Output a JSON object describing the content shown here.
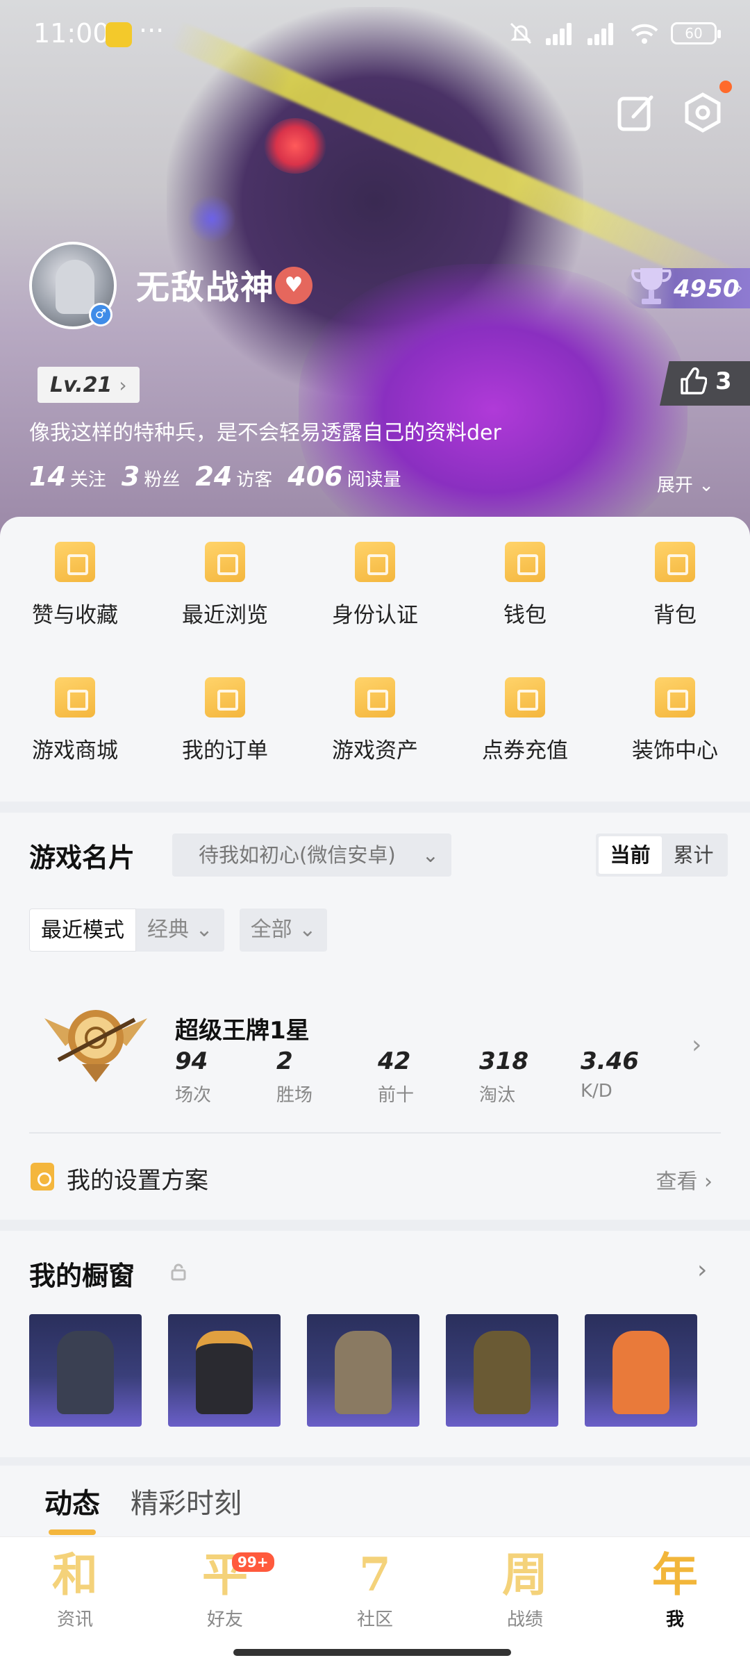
{
  "status_bar": {
    "time": "11:00",
    "battery": "60"
  },
  "profile": {
    "nickname": "无敌战神",
    "level": "Lv.21",
    "trophy_points": "4950",
    "likes": "3",
    "signature": "像我这样的特种兵，是不会轻易透露自己的资料der",
    "stats": [
      {
        "value": "14",
        "label": "关注"
      },
      {
        "value": "3",
        "label": "粉丝"
      },
      {
        "value": "24",
        "label": "访客"
      },
      {
        "value": "406",
        "label": "阅读量"
      }
    ],
    "expand_label": "展开"
  },
  "quick_actions": [
    {
      "label": "赞与收藏",
      "icon": "bookmark-heart-icon"
    },
    {
      "label": "最近浏览",
      "icon": "recent-icon"
    },
    {
      "label": "身份认证",
      "icon": "verified-icon"
    },
    {
      "label": "钱包",
      "icon": "wallet-icon"
    },
    {
      "label": "背包",
      "icon": "backpack-icon"
    },
    {
      "label": "游戏商城",
      "icon": "shop-bag-icon"
    },
    {
      "label": "我的订单",
      "icon": "orders-icon"
    },
    {
      "label": "游戏资产",
      "icon": "assets-icon"
    },
    {
      "label": "点券充值",
      "icon": "recharge-icon"
    },
    {
      "label": "装饰中心",
      "icon": "decoration-icon"
    }
  ],
  "game_card": {
    "title": "游戏名片",
    "account_select": "待我如初心(微信安卓)",
    "toggle": [
      "当前",
      "累计"
    ],
    "mode_chips": [
      "最近模式",
      "经典"
    ],
    "filter_chip": "全部",
    "rank_name": "超级王牌1星",
    "rank_stats": [
      {
        "value": "94",
        "label": "场次"
      },
      {
        "value": "2",
        "label": "胜场"
      },
      {
        "value": "42",
        "label": "前十"
      },
      {
        "value": "318",
        "label": "淘汰"
      },
      {
        "value": "3.46",
        "label": "K/D"
      }
    ],
    "settings_title": "我的设置方案",
    "settings_link": "查看"
  },
  "showcase": {
    "title": "我的橱窗",
    "items": [
      "outfit-1",
      "outfit-2",
      "outfit-3",
      "outfit-4",
      "outfit-5"
    ]
  },
  "feed_tabs": [
    "动态",
    "精彩时刻"
  ],
  "bottom_nav": [
    {
      "glyph": "和",
      "label": "资讯"
    },
    {
      "glyph": "平",
      "label": "好友",
      "badge": "99+"
    },
    {
      "glyph": "7",
      "label": "社区"
    },
    {
      "glyph": "周",
      "label": "战绩"
    },
    {
      "glyph": "年",
      "label": "我"
    }
  ],
  "colors": {
    "accent": "#f4b63d",
    "heart": "#e5675d",
    "badge": "#ff5a3d"
  }
}
